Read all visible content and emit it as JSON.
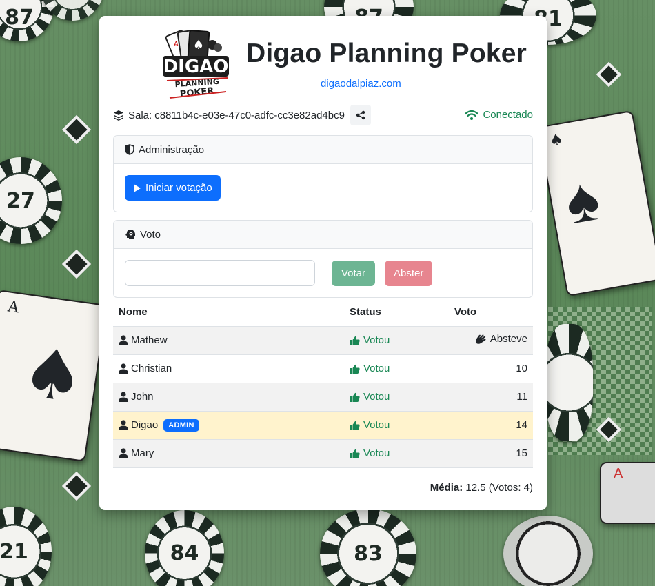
{
  "app": {
    "title": "Digao Planning Poker",
    "site_link": "digaodalpiaz.com",
    "logo_text": [
      "DIGAO",
      "PLANNING",
      "POKER"
    ]
  },
  "room": {
    "label": "Sala:",
    "id": "c8811b4c-e03e-47c0-adfc-cc3e82ad4bc9",
    "connection": "Conectado"
  },
  "admin_box": {
    "title": "Administração",
    "start_button": "Iniciar votação"
  },
  "vote_box": {
    "title": "Voto",
    "input_value": "",
    "input_placeholder": "",
    "vote_button": "Votar",
    "abstain_button": "Abster"
  },
  "table": {
    "headers": {
      "name": "Nome",
      "status": "Status",
      "vote": "Voto"
    },
    "rows": [
      {
        "name": "Mathew",
        "status": "Votou",
        "vote": "Absteve",
        "admin": false
      },
      {
        "name": "Christian",
        "status": "Votou",
        "vote": "10",
        "admin": false
      },
      {
        "name": "John",
        "status": "Votou",
        "vote": "11",
        "admin": false
      },
      {
        "name": "Digao",
        "status": "Votou",
        "vote": "14",
        "admin": true,
        "badge": "ADMIN"
      },
      {
        "name": "Mary",
        "status": "Votou",
        "vote": "15",
        "admin": false
      }
    ]
  },
  "summary": {
    "avg_label": "Média:",
    "avg_value": "12.5",
    "votes_text": "(Votos: 4)"
  },
  "background_chips": [
    "87",
    "27",
    "27",
    "21",
    "84",
    "83",
    "81",
    "87"
  ],
  "colors": {
    "primary": "#0d6efd",
    "success": "#198754",
    "vote_button": "#6db593",
    "abstain_button": "#e7858f",
    "admin_row": "#fff3cd"
  }
}
